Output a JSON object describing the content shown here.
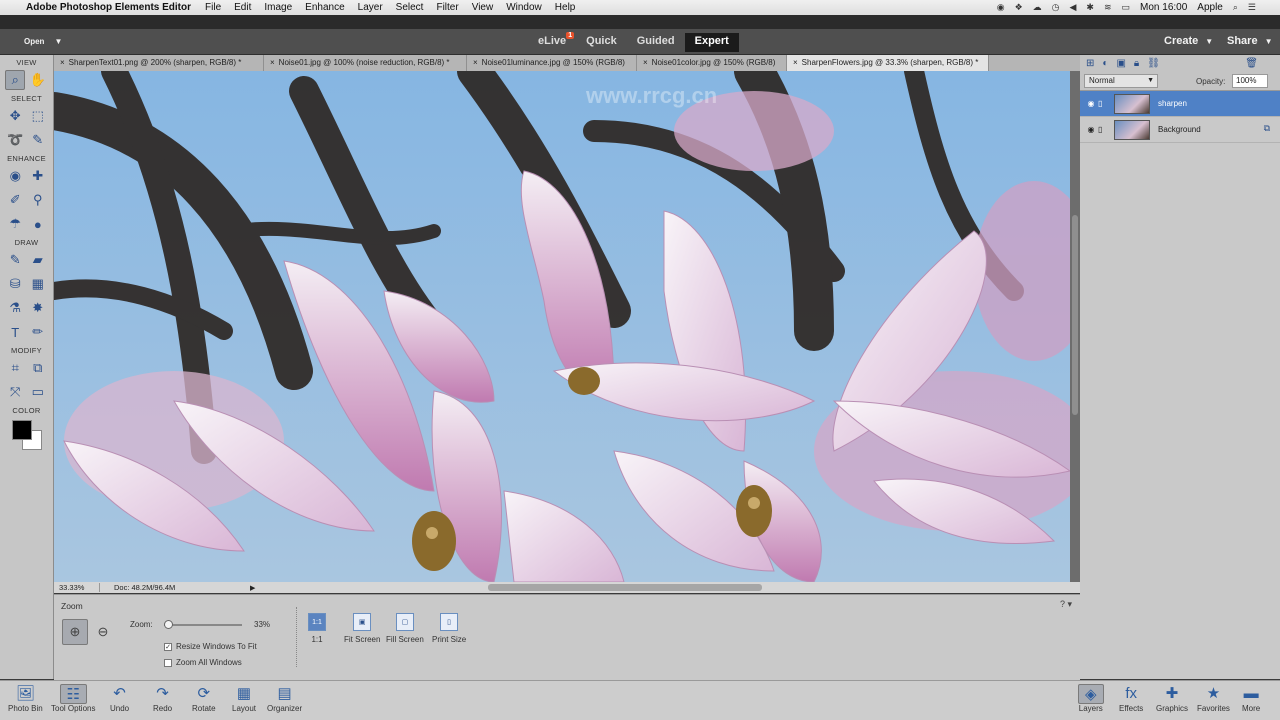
{
  "menubar": {
    "app_name": "Adobe Photoshop Elements Editor",
    "items": [
      "File",
      "Edit",
      "Image",
      "Enhance",
      "Layer",
      "Select",
      "Filter",
      "View",
      "Window",
      "Help"
    ],
    "clock": "Mon 16:00",
    "user": "Apple"
  },
  "topbar": {
    "open": "Open",
    "modes": [
      {
        "label": "eLive",
        "badge": "1"
      },
      {
        "label": "Quick"
      },
      {
        "label": "Guided"
      },
      {
        "label": "Expert"
      }
    ],
    "create": "Create",
    "share": "Share"
  },
  "toolbox": {
    "sections": [
      "VIEW",
      "SELECT",
      "ENHANCE",
      "DRAW",
      "MODIFY",
      "COLOR"
    ]
  },
  "tabs": [
    "SharpenText01.png @ 200% (sharpen, RGB/8) *",
    "Noise01.jpg @ 100% (noise reduction, RGB/8) *",
    "Noise01luminance.jpg @ 150% (RGB/8)",
    "Noise01color.jpg @ 150% (RGB/8)",
    "SharpenFlowers.jpg @ 33.3% (sharpen, RGB/8) *"
  ],
  "status": {
    "zoom": "33.33%",
    "doc": "Doc: 48.2M/96.4M"
  },
  "tool_options": {
    "title": "Zoom",
    "zoom_label": "Zoom:",
    "zoom_value": "33%",
    "zoom_fraction": 0.0,
    "resize_windows": "Resize Windows To Fit",
    "zoom_all": "Zoom All Windows",
    "view_buttons": [
      "1:1",
      "Fit Screen",
      "Fill Screen",
      "Print Size"
    ]
  },
  "layers_panel": {
    "blend_mode": "Normal",
    "opacity_label": "Opacity:",
    "opacity_value": "100%",
    "layers": [
      {
        "name": "sharpen"
      },
      {
        "name": "Background"
      }
    ]
  },
  "bottombar": {
    "left": [
      "Photo Bin",
      "Tool Options",
      "Undo",
      "Redo",
      "Rotate",
      "Layout",
      "Organizer"
    ],
    "right": [
      "Layers",
      "Effects",
      "Graphics",
      "Favorites",
      "More"
    ]
  },
  "watermark": "www.rrcg.cn"
}
